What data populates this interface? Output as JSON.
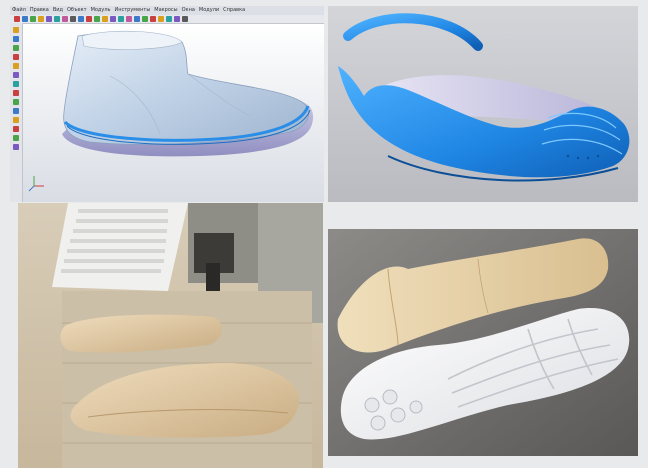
{
  "cad_window": {
    "menu_items": [
      "Файл",
      "Правка",
      "Вид",
      "Объект",
      "Модуль",
      "Инструменты",
      "Макросы",
      "Окна",
      "Модули",
      "Справка"
    ],
    "toolbar_icon_colors": [
      "#c84040",
      "#3b7ac9",
      "#4aa54a",
      "#d9a020",
      "#7a5ac0",
      "#2aa0a0",
      "#c05a9a",
      "#5a5a5a",
      "#3b7ac9",
      "#c84040",
      "#4aa54a",
      "#d9a020",
      "#7a5ac0",
      "#2aa0a0",
      "#c05a9a",
      "#3b7ac9",
      "#4aa54a",
      "#c84040",
      "#d9a020",
      "#2aa0a0",
      "#7a5ac0",
      "#5a5a5a"
    ],
    "side_icon_colors": [
      "#d9a020",
      "#3b7ac9",
      "#4aa54a",
      "#c84040",
      "#d9a020",
      "#7a5ac0",
      "#2aa0a0",
      "#c84040",
      "#4aa54a",
      "#3b7ac9",
      "#d9a020",
      "#c84040",
      "#4aa54a",
      "#7a5ac0"
    ]
  },
  "colors": {
    "shoe_blue": "#2a8ee8",
    "shoe_light": "#c6d6e8",
    "sole_lavender": "#b9b8dc",
    "wood": "#e7d1a8",
    "white_sole": "#f3f4f6"
  }
}
